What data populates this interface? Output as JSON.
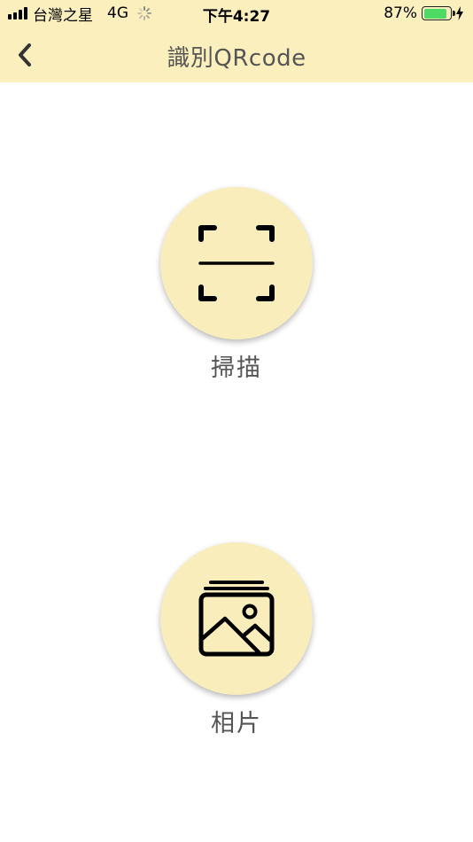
{
  "status_bar": {
    "carrier": "台灣之星",
    "network": "4G",
    "time": "下午4:27",
    "battery_percent": "87%",
    "battery_level": 0.87,
    "icons": [
      "signal-bars-icon",
      "activity-spinner-icon",
      "battery-icon",
      "charging-bolt-icon"
    ]
  },
  "nav": {
    "title": "識別QRcode",
    "back_icon": "chevron-left-icon"
  },
  "actions": {
    "scan": {
      "label": "掃描",
      "icon": "scan-frame-icon"
    },
    "photo": {
      "label": "相片",
      "icon": "photo-gallery-icon"
    }
  },
  "colors": {
    "header_bg": "#fbf0bd",
    "circle_bg": "#f9edbb",
    "label_text": "#555555",
    "battery_fill": "#4cd964"
  }
}
